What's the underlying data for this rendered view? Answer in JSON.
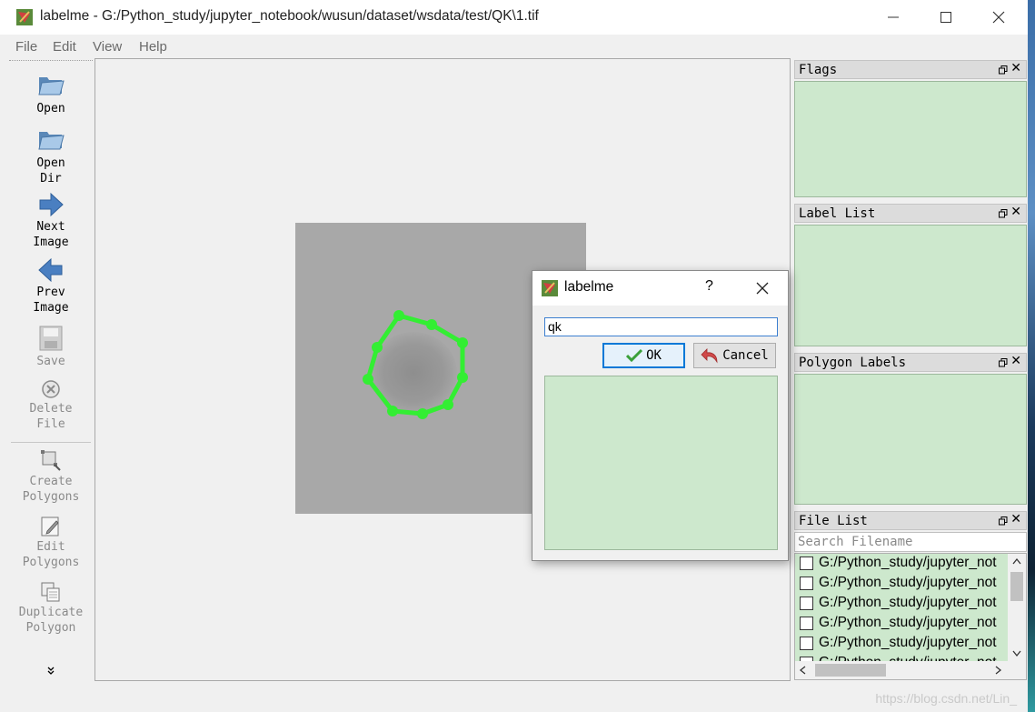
{
  "window": {
    "title": "labelme - G:/Python_study/jupyter_notebook/wusun/dataset/wsdata/test/QK\\1.tif",
    "controls": [
      "minimize-icon",
      "maximize-icon",
      "close-icon"
    ]
  },
  "menubar": {
    "items": [
      "File",
      "Edit",
      "View",
      "Help"
    ]
  },
  "toolbar": {
    "open": "Open",
    "open_dir": "Open\nDir",
    "next_image": "Next\nImage",
    "prev_image": "Prev\nImage",
    "save": "Save",
    "delete_file": "Delete\nFile",
    "create_polygons": "Create\nPolygons",
    "edit_polygons": "Edit\nPolygons",
    "duplicate_polygon": "Duplicate\nPolygon",
    "more": "»"
  },
  "docks": {
    "flags": "Flags",
    "label_list": "Label List",
    "polygon_labels": "Polygon Labels",
    "file_list": "File List",
    "search_placeholder": "Search Filename",
    "files": [
      "G:/Python_study/jupyter_not",
      "G:/Python_study/jupyter_not",
      "G:/Python_study/jupyter_not",
      "G:/Python_study/jupyter_not",
      "G:/Python_study/jupyter_not",
      "G:/Python_study/jupyter_not"
    ]
  },
  "dialog": {
    "title": "labelme",
    "help": "?",
    "input_value": "qk",
    "ok_label": "OK",
    "cancel_label": "Cancel"
  },
  "statusbar": {
    "watermark": "https://blog.csdn.net/Lin_"
  },
  "colors": {
    "polygon": "#33ee33",
    "dock_background": "#cde8cd",
    "accent": "#0078d7"
  }
}
